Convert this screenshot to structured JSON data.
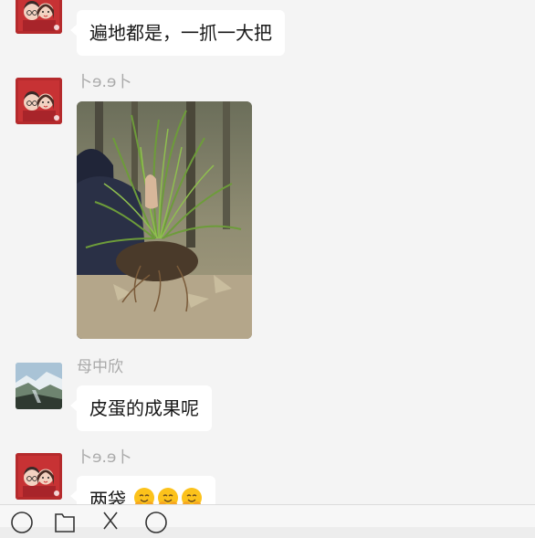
{
  "messages": [
    {
      "sender": "",
      "text": "遍地都是，一抓一大把"
    },
    {
      "sender": "卜ɘ.ɘ卜",
      "type": "image"
    },
    {
      "sender": "母中欣",
      "text": "皮蛋的成果呢"
    },
    {
      "sender": "卜ɘ.ɘ卜",
      "text": "两袋",
      "emoji_icons": [
        "hugging-face-icon",
        "hugging-face-icon",
        "hugging-face-icon"
      ]
    }
  ],
  "toolbar": {
    "icons": [
      "emoji-icon",
      "folder-icon",
      "scissors-icon",
      "chat-history-icon"
    ]
  },
  "colors": {
    "avatar_couple_bg": "#b52a2c",
    "bubble_bg": "#ffffff",
    "chat_bg": "#f4f4f4",
    "name_color": "#a9a9a9"
  }
}
